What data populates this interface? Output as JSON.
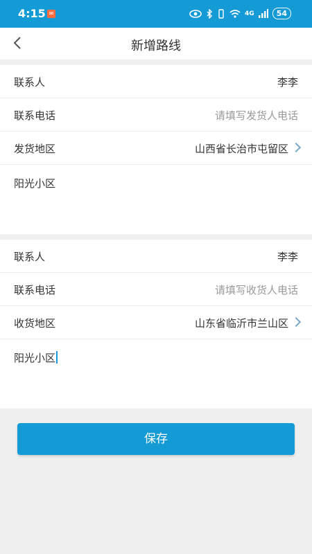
{
  "status": {
    "time": "4:15",
    "notif_icon": "app-notification-icon",
    "network": "4G",
    "battery": "54"
  },
  "nav": {
    "title": "新增路线",
    "back_icon": "chevron-left-icon"
  },
  "sender": {
    "contact_label": "联系人",
    "contact_value": "李李",
    "phone_label": "联系电话",
    "phone_placeholder": "请填写发货人电话",
    "region_label": "发货地区",
    "region_value": "山西省长治市屯留区",
    "address_value": "阳光小区"
  },
  "receiver": {
    "contact_label": "联系人",
    "contact_value": "李李",
    "phone_label": "联系电话",
    "phone_placeholder": "请填写收货人电话",
    "region_label": "收货地区",
    "region_value": "山东省临沂市兰山区",
    "address_value": "阳光小区"
  },
  "save_label": "保存",
  "colors": {
    "accent": "#149ad4",
    "background": "#efefef"
  }
}
